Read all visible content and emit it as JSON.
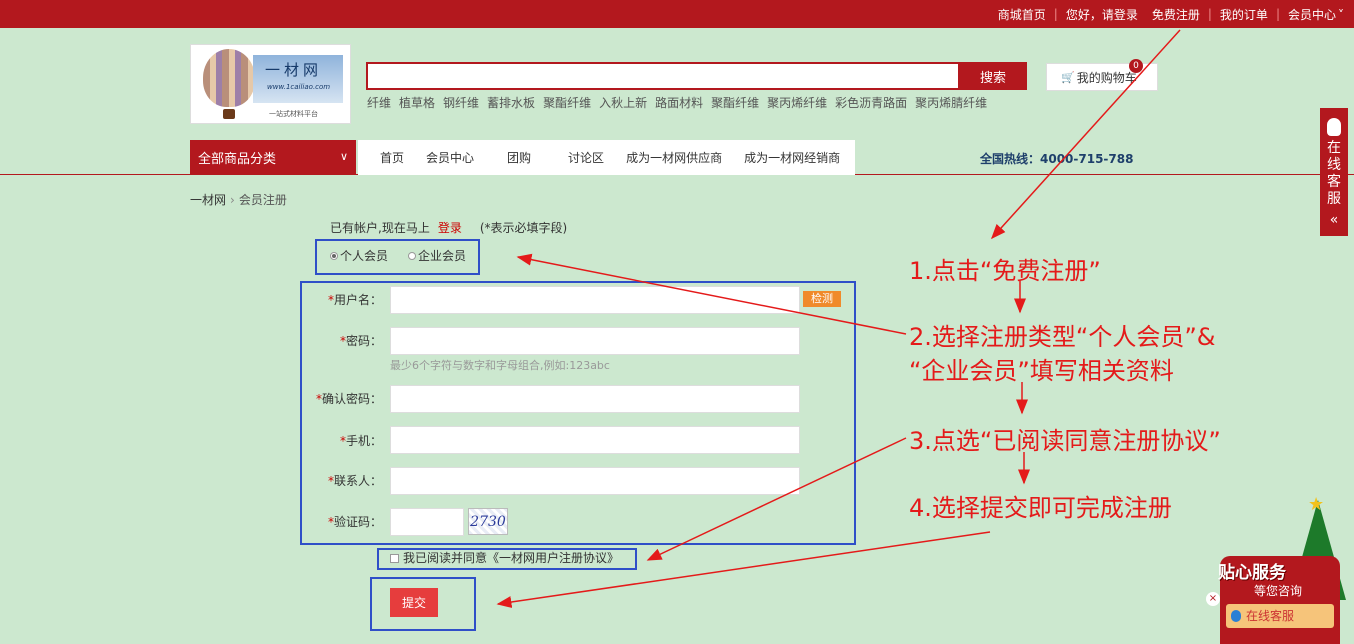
{
  "topbar": {
    "links": [
      "商城首页",
      "您好，请登录",
      "免费注册",
      "我的订单",
      "会员中心"
    ]
  },
  "logo": {
    "name": "一材网",
    "url": "www.1cailiao.com",
    "slogan": "一站式材料平台"
  },
  "search": {
    "value": "",
    "button": "搜索",
    "hot_keywords": [
      "纤维",
      "植草格",
      "钢纤维",
      "蓄排水板",
      "聚酯纤维",
      "入秋上新",
      "路面材料",
      "聚酯纤维",
      "聚丙烯纤维",
      "彩色沥青路面",
      "聚丙烯腈纤维"
    ]
  },
  "cart": {
    "label": "我的购物车",
    "count": "0"
  },
  "nav": {
    "category_menu": "全部商品分类",
    "items": [
      "首页",
      "会员中心",
      "团购",
      "讨论区",
      "成为一材网供应商",
      "成为一材网经销商"
    ],
    "hotline": "全国热线：4000-715-788"
  },
  "breadcrumb": {
    "home": "一材网",
    "current": "会员注册"
  },
  "form": {
    "have_account_text": "已有帐户,现在马上",
    "login_link": "登录",
    "required_note": "(*表示必填字段)",
    "member_types": [
      {
        "label": "个人会员",
        "selected": true
      },
      {
        "label": "企业会员",
        "selected": false
      }
    ],
    "fields": {
      "username": {
        "label": "用户名：",
        "value": ""
      },
      "password": {
        "label": "密码：",
        "value": "",
        "hint": "最少6个字符与数字和字母组合,例如:123abc"
      },
      "confirm": {
        "label": "确认密码：",
        "value": ""
      },
      "phone": {
        "label": "手机：",
        "value": ""
      },
      "contact": {
        "label": "联系人：",
        "value": ""
      },
      "captcha": {
        "label": "验证码：",
        "value": "",
        "image_text": "2730"
      }
    },
    "check_button": "检测",
    "agree_text": "我已阅读并同意《一材网用户注册协议》",
    "submit": "提交"
  },
  "side_service": {
    "label": "在线客服",
    "collapse": "«"
  },
  "service_widget": {
    "title": "贴心服务",
    "subtitle": "等您咨询",
    "online": "在线客服",
    "close": "×"
  },
  "annotations": {
    "step1": "1.点击“免费注册”",
    "step2a": "2.选择注册类型“个人会员”&",
    "step2b": "“企业会员”填写相关资料",
    "step3": "3.点选“已阅读同意注册协议”",
    "step4": "4.选择提交即可完成注册"
  },
  "colors": {
    "brand_red": "#b3181e",
    "page_bg": "#cce8cf",
    "annotation_red": "#e41a1a",
    "highlight_box": "#2f4fc8",
    "check_button": "#f08a2a"
  }
}
